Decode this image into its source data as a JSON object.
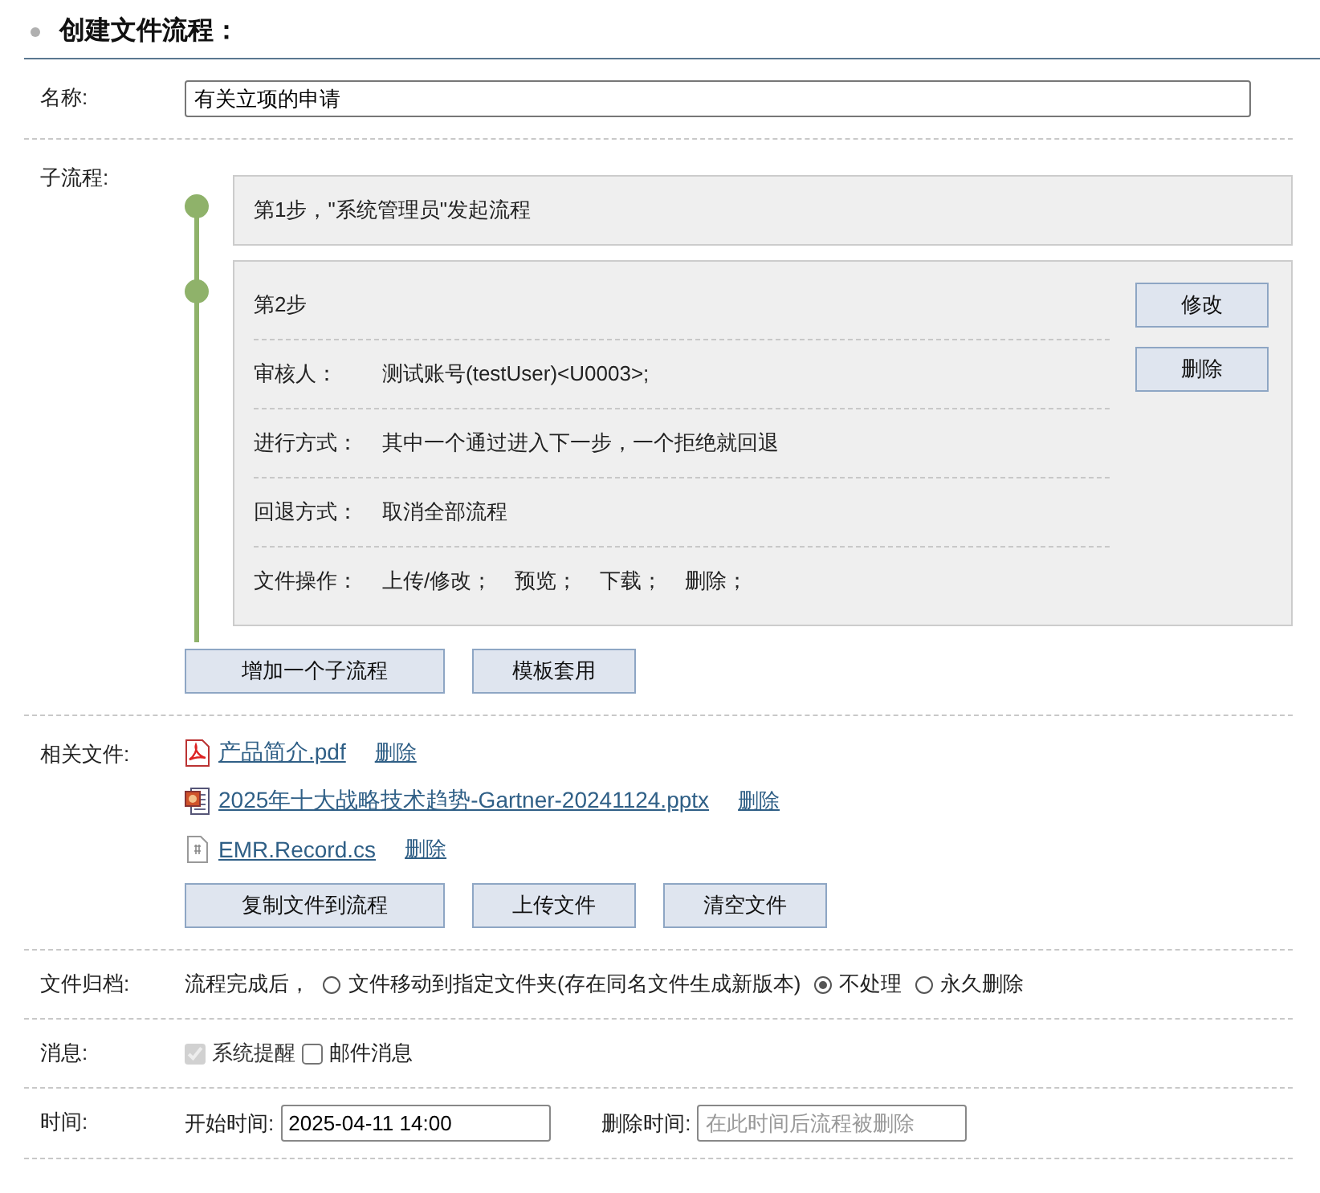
{
  "title": "创建文件流程：",
  "name_field": {
    "label": "名称:",
    "value": "有关立项的申请"
  },
  "subflow": {
    "label": "子流程:",
    "steps": [
      {
        "kind": "simple",
        "text": "第1步，\"系统管理员\"发起流程"
      },
      {
        "kind": "detailed",
        "title": "第2步",
        "details": [
          {
            "label": "审核人：",
            "values": [
              "测试账号(testUser)<U0003>;"
            ]
          },
          {
            "label": "进行方式：",
            "values": [
              "其中一个通过进入下一步，一个拒绝就回退"
            ]
          },
          {
            "label": "回退方式：",
            "values": [
              "取消全部流程"
            ]
          },
          {
            "label": "文件操作：",
            "values": [
              "上传/修改；",
              "预览；",
              "下载；",
              "删除；"
            ]
          }
        ],
        "buttons": [
          "修改",
          "删除"
        ]
      }
    ],
    "buttons": [
      "增加一个子流程",
      "模板套用"
    ]
  },
  "files": {
    "label": "相关文件:",
    "items": [
      {
        "kind": "pdf",
        "name": "产品简介.pdf",
        "action": "删除"
      },
      {
        "kind": "pptx",
        "name": "2025年十大战略技术趋势-Gartner-20241124.pptx",
        "action": "删除"
      },
      {
        "kind": "code",
        "name": "EMR.Record.cs",
        "action": "删除"
      }
    ],
    "buttons": [
      "复制文件到流程",
      "上传文件",
      "清空文件"
    ]
  },
  "archive": {
    "label": "文件归档:",
    "prefix": "流程完成后，",
    "options": [
      {
        "label": "文件移动到指定文件夹(存在同名文件生成新版本)",
        "selected": false
      },
      {
        "label": "不处理",
        "selected": true
      },
      {
        "label": "永久删除",
        "selected": false
      }
    ]
  },
  "messages": {
    "label": "消息:",
    "options": [
      {
        "label": "系统提醒",
        "checked": true,
        "disabled": true
      },
      {
        "label": "邮件消息",
        "checked": false,
        "disabled": false
      }
    ]
  },
  "time": {
    "label": "时间:",
    "start": {
      "label": "开始时间:",
      "value": "2025-04-11 14:00"
    },
    "end": {
      "label": "删除时间:",
      "placeholder": "在此时间后流程被删除"
    }
  }
}
